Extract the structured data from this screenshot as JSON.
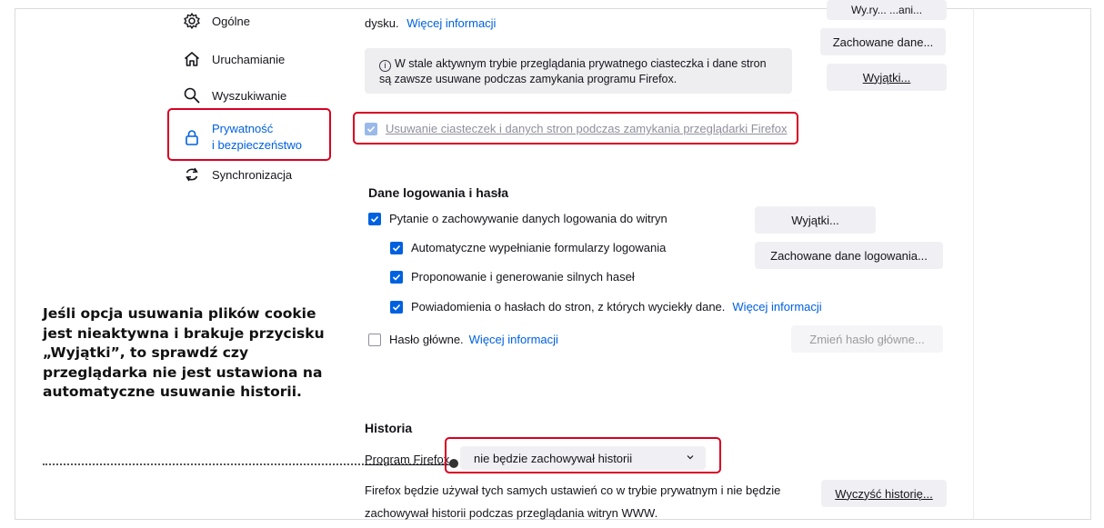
{
  "sidebar": {
    "items": [
      {
        "label": "Ogólne",
        "icon": "gear-icon"
      },
      {
        "label": "Uruchamianie",
        "icon": "home-icon"
      },
      {
        "label": "Wyszukiwanie",
        "icon": "search-icon"
      },
      {
        "label_line1": "Prywatność",
        "label_line2": "i bezpieczeństwo",
        "icon": "lock-icon",
        "active": true
      },
      {
        "label": "Synchronizacja",
        "icon": "sync-icon"
      }
    ]
  },
  "cookies": {
    "top_text": "dysku.",
    "top_link": "Więcej informacji",
    "btn_manage_partial": "Wy.ry... ...ani...",
    "btn_saved_data": "Zachowane dane...",
    "info_text": "W stale aktywnym trybie przeglądania prywatnego ciasteczka i dane stron są zawsze usuwane podczas zamykania programu Firefox.",
    "btn_exceptions": "Wyjątki...",
    "delete_on_close": "Usuwanie ciasteczek i danych stron podczas zamykania przeglądarki Firefox"
  },
  "logins": {
    "heading": "Dane logowania i hasła",
    "ask_save": "Pytanie o zachowywanie danych logowania do witryn",
    "autofill": "Automatyczne wypełnianie formularzy logowania",
    "suggest": "Proponowanie i generowanie silnych haseł",
    "alerts": "Powiadomienia o hasłach do stron, z których wyciekły dane.",
    "alerts_link": "Więcej informacji",
    "primary_password": "Hasło główne.",
    "primary_link": "Więcej informacji",
    "btn_exceptions": "Wyjątki...",
    "btn_saved_logins": "Zachowane dane logowania...",
    "btn_change_primary": "Zmień hasło główne..."
  },
  "history": {
    "heading": "Historia",
    "label": "Program Firefox",
    "select_value": "nie będzie zachowywał historii",
    "description_line1": "Firefox będzie używał tych samych ustawień co w trybie prywatnym i nie będzie",
    "description_line2": "zachowywał historii podczas przeglądania witryn WWW.",
    "btn_clear": "Wyczyść historię..."
  },
  "annotation": {
    "text": "Jeśli opcja usuwania plików cookie jest nieaktywna i brakuje przycisku „Wyjątki”, to sprawdź czy przeglądarka nie jest ustawiona na automatyczne usuwanie historii."
  },
  "colors": {
    "accent": "#0061e0",
    "highlight": "#d70022",
    "button_bg": "#f0f0f4"
  }
}
